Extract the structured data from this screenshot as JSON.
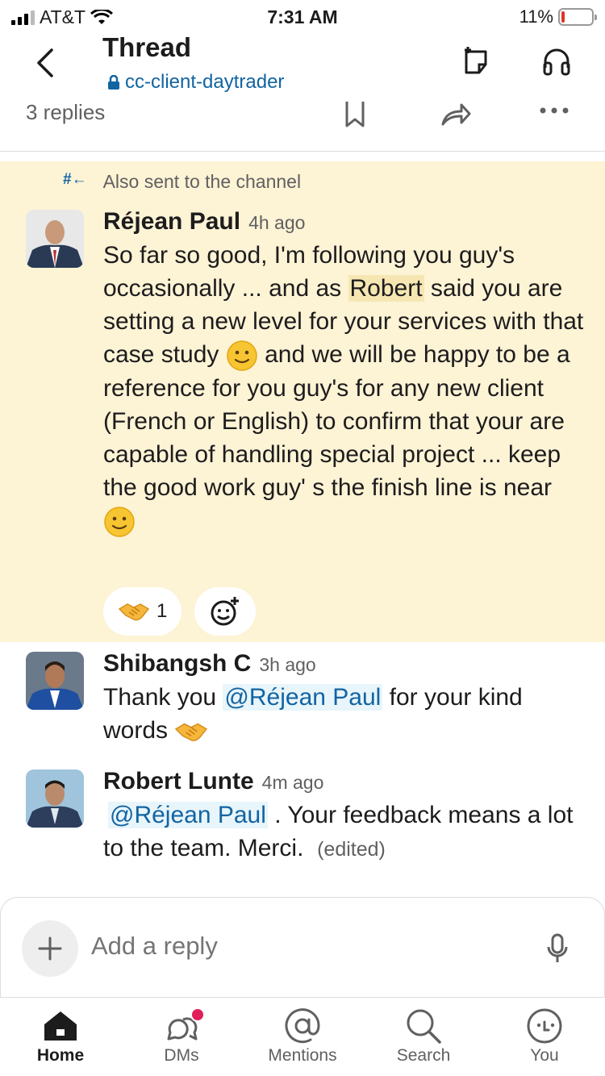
{
  "status_bar": {
    "carrier": "AT&T",
    "time": "7:31 AM",
    "battery": "11%",
    "battery_level": 0.11
  },
  "header": {
    "title": "Thread",
    "channel": "cc-client-daytrader"
  },
  "thread_meta": {
    "replies": "3 replies"
  },
  "highlighted": {
    "also_sent": "Also sent to the channel"
  },
  "messages": [
    {
      "author": "Réjean Paul",
      "time": "4h ago",
      "text_1": "So far so good, I'm following you guy's occasionally ... and as ",
      "highlight": "Robert",
      "text_2": " said you are setting a new level for your services with that case study ",
      "text_3": " and we will be happy to be a reference for you guy's for any new client (French or English) to confirm that your are capable of handling special project ... keep the good work guy' s the finish line is near",
      "reaction_count": "1"
    },
    {
      "author": "Shibangsh C",
      "time": "3h ago",
      "text_1": "Thank you ",
      "mention": "@Réjean Paul",
      "text_2": " for your kind words "
    },
    {
      "author": "Robert Lunte",
      "time": "4m ago",
      "mention": "@Réjean Paul",
      "text_1": " . Your feedback means a lot to the team. Merci.",
      "edited": "(edited)"
    }
  ],
  "composer": {
    "placeholder": "Add a reply"
  },
  "tabs": [
    {
      "label": "Home"
    },
    {
      "label": "DMs"
    },
    {
      "label": "Mentions"
    },
    {
      "label": "Search"
    },
    {
      "label": "You"
    }
  ],
  "colors": {
    "link": "#1264a3",
    "highlight_bg": "#fdf3d5",
    "badge": "#e01e5a",
    "battery_low": "#e0332b"
  }
}
